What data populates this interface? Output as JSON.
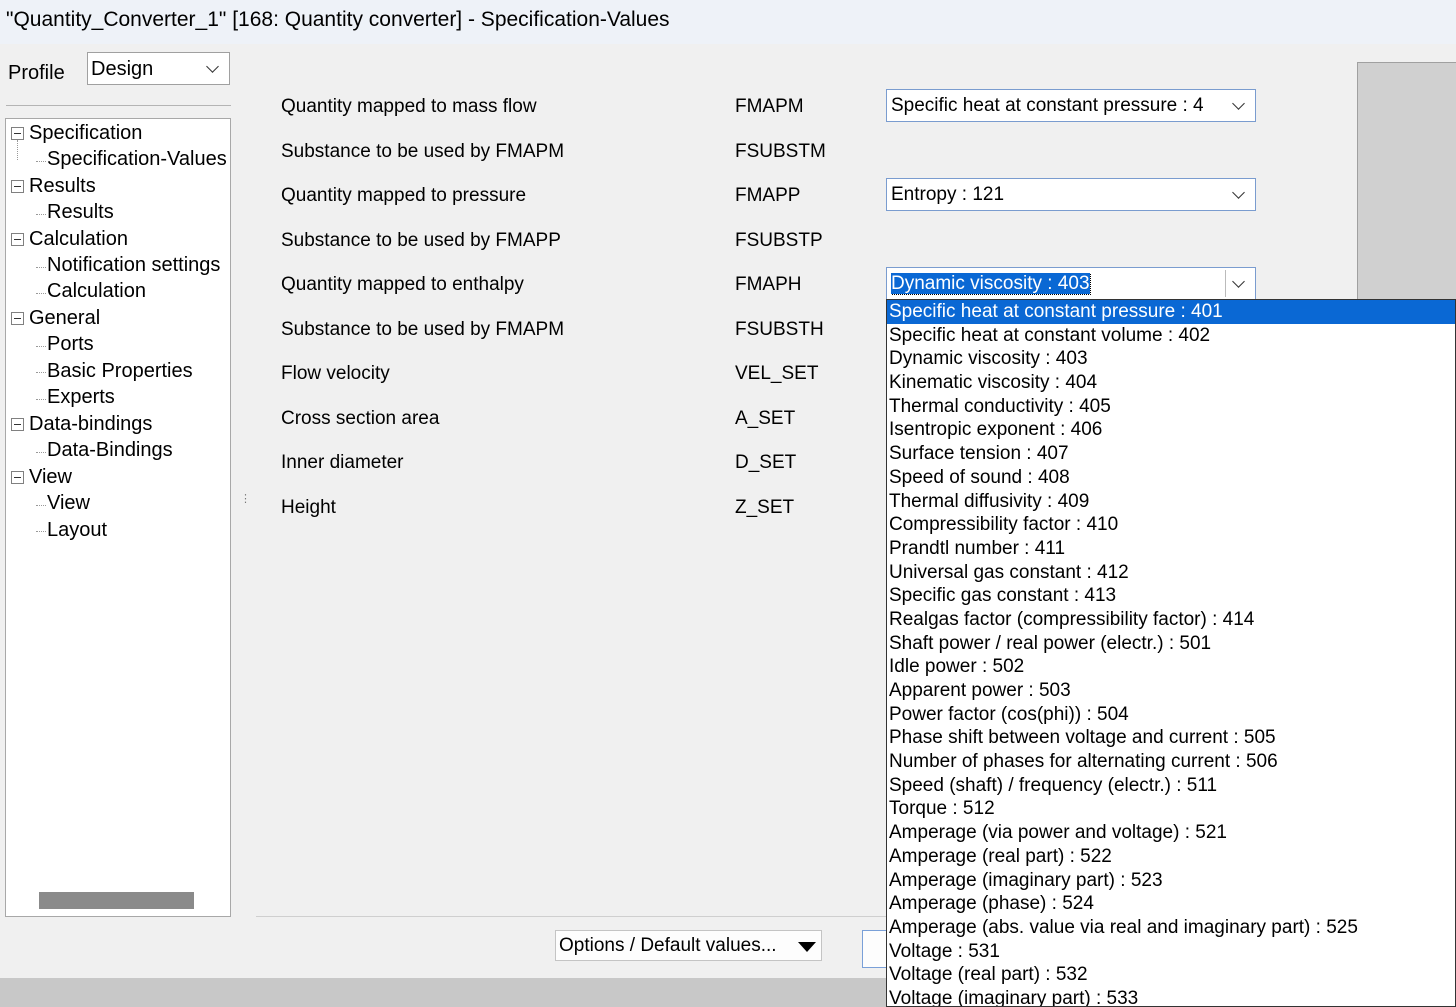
{
  "window": {
    "title": "\"Quantity_Converter_1\" [168: Quantity converter] - Specification-Values"
  },
  "profile": {
    "label": "Profile",
    "value": "Design"
  },
  "tree": [
    {
      "label": "Specification",
      "children": [
        "Specification-Values"
      ]
    },
    {
      "label": "Results",
      "children": [
        "Results"
      ]
    },
    {
      "label": "Calculation",
      "children": [
        "Notification settings",
        "Calculation"
      ]
    },
    {
      "label": "General",
      "children": [
        "Ports",
        "Basic Properties",
        "Experts"
      ]
    },
    {
      "label": "Data-bindings",
      "children": [
        "Data-Bindings"
      ]
    },
    {
      "label": "View",
      "children": [
        "View",
        "Layout"
      ]
    }
  ],
  "form": {
    "rows": [
      {
        "label": "Quantity mapped to mass flow",
        "code": "FMAPM",
        "value": "Specific heat at constant pressure : 4"
      },
      {
        "label": "Substance to be used by FMAPM",
        "code": "FSUBSTM"
      },
      {
        "label": "Quantity mapped to pressure",
        "code": "FMAPP",
        "value": "Entropy : 121"
      },
      {
        "label": "Substance to be used by FMAPP",
        "code": "FSUBSTP"
      },
      {
        "label": "Quantity mapped to enthalpy",
        "code": "FMAPH",
        "value": "Dynamic viscosity : 403"
      },
      {
        "label": "Substance to be used by FMAPM",
        "code": "FSUBSTH"
      },
      {
        "label": "Flow velocity",
        "code": "VEL_SET"
      },
      {
        "label": "Cross section area",
        "code": "A_SET"
      },
      {
        "label": "Inner diameter",
        "code": "D_SET"
      },
      {
        "label": "Height",
        "code": "Z_SET"
      }
    ]
  },
  "dropdown": {
    "selected_index": 0,
    "options": [
      "Specific heat at constant pressure : 401",
      "Specific heat at constant volume : 402",
      "Dynamic viscosity : 403",
      "Kinematic viscosity : 404",
      "Thermal conductivity : 405",
      "Isentropic exponent : 406",
      "Surface tension : 407",
      "Speed of sound : 408",
      "Thermal diffusivity : 409",
      "Compressibility factor : 410",
      "Prandtl number : 411",
      "Universal gas constant : 412",
      "Specific gas constant : 413",
      "Realgas factor (compressibility factor) : 414",
      "Shaft power / real power (electr.) : 501",
      "Idle power : 502",
      "Apparent power : 503",
      "Power factor (cos(phi)) : 504",
      "Phase shift between voltage and current : 505",
      "Number of phases for alternating current : 506",
      "Speed (shaft) / frequency (electr.) : 511",
      "Torque : 512",
      "Amperage (via power and voltage) : 521",
      "Amperage (real part) : 522",
      "Amperage (imaginary part) : 523",
      "Amperage (phase) : 524",
      "Amperage (abs. value via real and imaginary part) : 525",
      "Voltage : 531",
      "Voltage (real part) : 532",
      "Voltage (imaginary part) : 533"
    ]
  },
  "buttons": {
    "options_label": "Options / Default values..."
  }
}
